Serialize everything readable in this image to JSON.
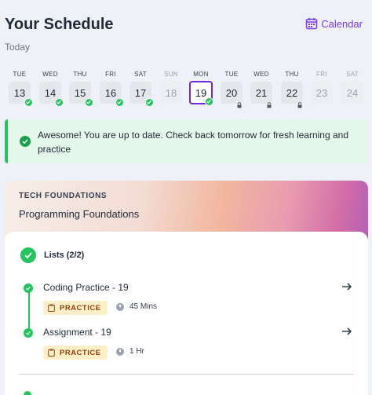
{
  "header": {
    "title": "Your Schedule",
    "calendar_label": "Calendar"
  },
  "today_label": "Today",
  "days": [
    {
      "name": "TUE",
      "num": "13",
      "state": "done"
    },
    {
      "name": "WED",
      "num": "14",
      "state": "done"
    },
    {
      "name": "THU",
      "num": "15",
      "state": "done"
    },
    {
      "name": "FRI",
      "num": "16",
      "state": "done"
    },
    {
      "name": "SAT",
      "num": "17",
      "state": "done"
    },
    {
      "name": "SUN",
      "num": "18",
      "state": "disabled"
    },
    {
      "name": "MON",
      "num": "19",
      "state": "selected-done"
    },
    {
      "name": "TUE",
      "num": "20",
      "state": "locked"
    },
    {
      "name": "WED",
      "num": "21",
      "state": "locked"
    },
    {
      "name": "THU",
      "num": "22",
      "state": "locked"
    },
    {
      "name": "FRI",
      "num": "23",
      "state": "disabled"
    },
    {
      "name": "SAT",
      "num": "24",
      "state": "disabled"
    }
  ],
  "alert": {
    "message": "Awesome! You are up to date. Check back tomorrow for fresh learning and practice"
  },
  "course": {
    "category": "TECH FOUNDATIONS",
    "name": "Programming Foundations",
    "lists_label": "Lists (2/2)",
    "items": [
      {
        "name": "Coding Practice - 19",
        "tag": "PRACTICE",
        "duration": "45 Mins"
      },
      {
        "name": "Assignment - 19",
        "tag": "PRACTICE",
        "duration": "1 Hr"
      }
    ]
  },
  "colors": {
    "accent": "#6d28d9",
    "success": "#22c55e",
    "tag_bg": "#fdf0c8"
  }
}
